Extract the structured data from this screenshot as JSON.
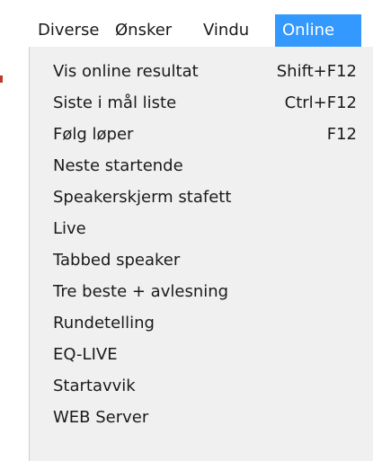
{
  "menubar": {
    "items": [
      {
        "label": "Diverse",
        "active": false
      },
      {
        "label": "Ønsker",
        "active": false
      },
      {
        "label": "Vindu",
        "active": false
      },
      {
        "label": "Online",
        "active": true
      }
    ]
  },
  "online_menu": {
    "items": [
      {
        "label": "Vis online resultat",
        "shortcut": "Shift+F12"
      },
      {
        "label": "Siste i mål liste",
        "shortcut": "Ctrl+F12"
      },
      {
        "label": "Følg løper",
        "shortcut": "F12"
      },
      {
        "label": "Neste startende",
        "shortcut": ""
      },
      {
        "label": "Speakerskjerm stafett",
        "shortcut": ""
      },
      {
        "label": "Live",
        "shortcut": ""
      },
      {
        "label": "Tabbed speaker",
        "shortcut": ""
      },
      {
        "label": "Tre beste + avlesning",
        "shortcut": ""
      },
      {
        "label": "Rundetelling",
        "shortcut": ""
      },
      {
        "label": "EQ-LIVE",
        "shortcut": ""
      },
      {
        "label": "Startavvik",
        "shortcut": ""
      },
      {
        "label": "WEB Server",
        "shortcut": ""
      }
    ]
  },
  "colors": {
    "highlight": "#3399ff",
    "menu_background": "#f0f0f0",
    "text": "#1a1a1a"
  }
}
